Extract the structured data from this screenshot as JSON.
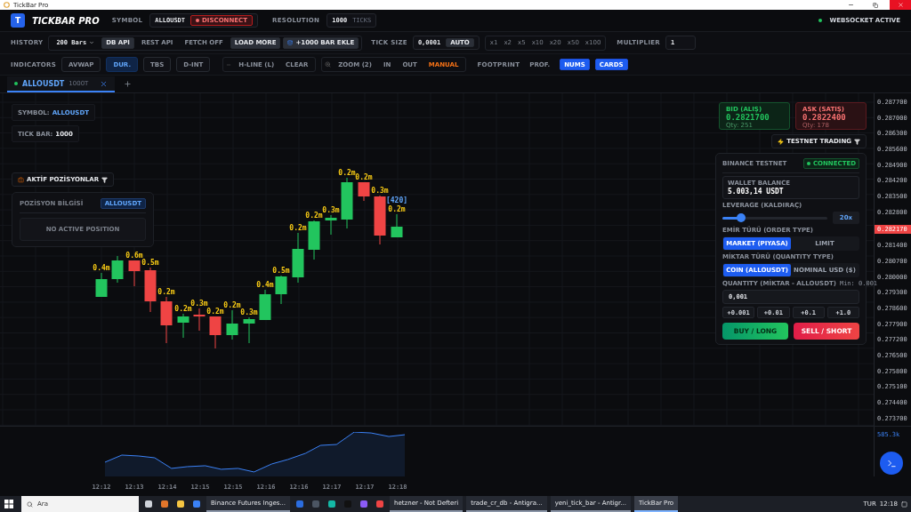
{
  "window": {
    "title": "TickBar Pro"
  },
  "header": {
    "logo_letter": "T",
    "app_name": "TICKBAR PRO",
    "symbol_label": "SYMBOL",
    "symbol_value": "ALLOUSDT",
    "disconnect": "DISCONNECT",
    "resolution_label": "RESOLUTION",
    "resolution_value": "1000",
    "resolution_unit": "TICKS",
    "status": {
      "label": "WEBSOCKET ACTIVE",
      "connected": true
    }
  },
  "toolbar": {
    "history_label": "HISTORY",
    "history_value": "200 Bars",
    "sources": [
      {
        "label": "DB API",
        "selected": true
      },
      {
        "label": "REST API",
        "selected": false
      }
    ],
    "fetch": "FETCH OFF",
    "load_more": "LOAD MORE",
    "add_bars": "+1000 BAR EKLE",
    "tick_size_label": "TICK SIZE",
    "tick_size_value": "0,0001",
    "auto": "AUTO",
    "tick_multipliers": [
      "x1",
      "x2",
      "x5",
      "x10",
      "x20",
      "x50",
      "x100"
    ],
    "multiplier_label": "MULTIPLIER",
    "multiplier_value": "1"
  },
  "indicators": {
    "label": "INDICATORS",
    "items": [
      {
        "label": "AVWAP",
        "selected": false
      },
      {
        "label": "DUR.",
        "selected": true
      },
      {
        "label": "TBS",
        "selected": false
      },
      {
        "label": "D-INT",
        "selected": false
      }
    ],
    "hline": "H-LINE (L)",
    "clear": "CLEAR",
    "zoom": "ZOOM (2)",
    "zoom_in": "IN",
    "zoom_out": "OUT",
    "manual": "MANUAL",
    "footprint_label": "FOOTPRINT",
    "footprint_modes": [
      {
        "label": "PROF.",
        "selected": false
      },
      {
        "label": "NUMS",
        "selected": true
      },
      {
        "label": "CARDS",
        "selected": true
      }
    ]
  },
  "tabs": [
    {
      "label": "ALLOUSDT",
      "sub": "1000T",
      "selected": true
    }
  ],
  "chart": {
    "info": [
      {
        "label": "SYMBOL:",
        "value": "ALLOUSDT"
      },
      {
        "label": "TICK BAR:",
        "value": "1000"
      }
    ],
    "candles": [
      {
        "color": "#22c55e",
        "volume": "0.4m"
      },
      {
        "color": "#22c55e"
      },
      {
        "color": "#ef4444",
        "volume": "0.6m"
      },
      {
        "color": "#ef4444",
        "volume": "0.5m"
      },
      {
        "color": "#ef4444",
        "volume": "0.2m"
      },
      {
        "color": "#22c55e",
        "volume": "0.2m"
      },
      {
        "color": "#ef4444",
        "volume": "0.3m"
      },
      {
        "color": "#ef4444",
        "volume": "0.2m"
      },
      {
        "color": "#22c55e",
        "volume": "0.2m"
      },
      {
        "color": "#22c55e",
        "volume": "0.3m"
      },
      {
        "color": "#22c55e",
        "volume": "0.4m"
      },
      {
        "color": "#22c55e",
        "volume": "0.5m"
      },
      {
        "color": "#22c55e",
        "volume": "0.2m"
      },
      {
        "color": "#22c55e",
        "volume": "0.2m"
      },
      {
        "color": "#22c55e",
        "volume": "0.3m"
      },
      {
        "color": "#22c55e",
        "volume": "0.2m"
      },
      {
        "color": "#ef4444",
        "volume": "0.2m"
      },
      {
        "color": "#ef4444",
        "volume": "0.3m"
      },
      {
        "color": "#22c55e",
        "volume": "0.2m"
      }
    ],
    "last_bar_count": "[420]",
    "price_axis_upper": [
      "0.287700",
      "0.287000",
      "0.286300",
      "0.285600",
      "0.284900",
      "0.284200",
      "0.283500",
      "0.282800"
    ],
    "current_price": "0.282170",
    "price_axis_lower": [
      "0.281400",
      "0.280700",
      "0.280000",
      "0.279300",
      "0.278600",
      "0.277900",
      "0.277200",
      "0.276500",
      "0.275800",
      "0.275100",
      "0.274400",
      "0.273700"
    ],
    "volume_reading": "585.3k",
    "time_axis": [
      "12:12",
      "12:13",
      "12:14",
      "12:15",
      "12:15",
      "12:16",
      "12:16",
      "12:17",
      "12:17",
      "12:18"
    ]
  },
  "positions": {
    "toggle": "AKTİF POZİSYONLAR",
    "title": "POZİSYON BİLGİSİ",
    "symbol": "ALLOUSDT",
    "empty": "NO ACTIVE POSITION"
  },
  "quotes": [
    {
      "kind": "bid",
      "label": "BID (ALIŞ)",
      "price": "0.2821700",
      "qty": "Qty: 251"
    },
    {
      "kind": "ask",
      "label": "ASK (SATIŞ)",
      "price": "0.2822400",
      "qty": "Qty: 178"
    }
  ],
  "trading": {
    "toggle": "TESTNET TRADING",
    "title": "BINANCE TESTNET",
    "status": "CONNECTED",
    "wallet_label": "WALLET BALANCE",
    "wallet_value": "5.003,14 USDT",
    "leverage_label": "LEVERAGE (KALDIRAÇ)",
    "leverage": {
      "level": 0.18,
      "reading": "20x"
    },
    "order_type_label": "EMİR TÜRÜ (ORDER TYPE)",
    "order_types": [
      {
        "label": "MARKET (PIYASA)",
        "selected": true
      },
      {
        "label": "LIMIT",
        "selected": false
      }
    ],
    "quantity_type_label": "MİKTAR TÜRÜ (QUANTITY TYPE)",
    "quantity_types": [
      {
        "label": "COIN (ALLOUSDT)",
        "selected": true
      },
      {
        "label": "NOMINAL USD ($)",
        "selected": false
      }
    ],
    "quantity_label": "QUANTITY (MİKTAR - ALLOUSDT)",
    "quantity_min": "Min: 0.001",
    "quantity_value": "0,001",
    "quick_amounts": [
      "+0.001",
      "+0.01",
      "+0.1",
      "+1.0"
    ],
    "buy": "BUY / LONG",
    "sell": "SELL / SHORT"
  },
  "taskbar": {
    "search_placeholder": "Ara",
    "apps": [
      {
        "label": "Binance Futures Inges...",
        "selected": false
      },
      {
        "label": "hetzner - Not Defteri",
        "selected": false
      },
      {
        "label": "trade_cr_db - Antigra...",
        "selected": false
      },
      {
        "label": "yeni_tick_bar - Antigr...",
        "selected": false
      },
      {
        "label": "TickBar Pro",
        "selected": true
      }
    ],
    "language": "TUR",
    "time": "12:18"
  }
}
